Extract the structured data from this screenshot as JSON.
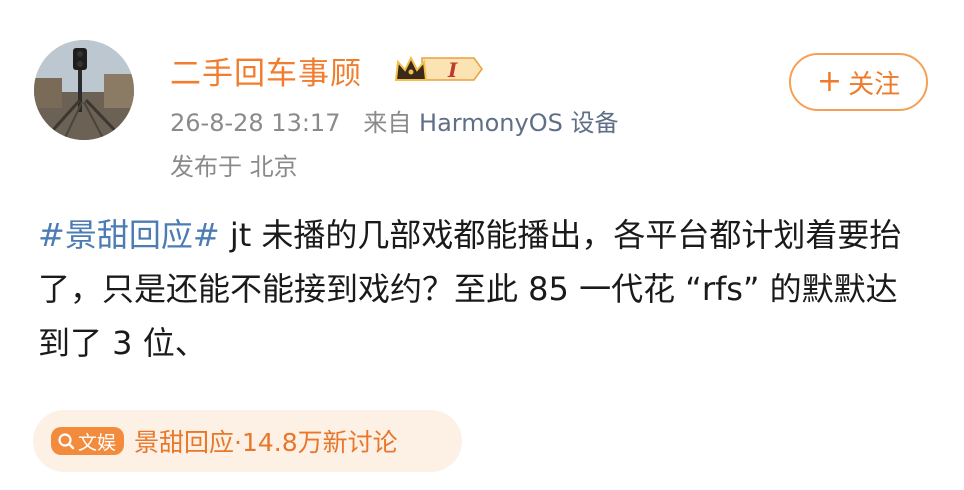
{
  "post": {
    "author": {
      "name": "二手回车事顾",
      "avatar_icon": "railway-signal-photo",
      "level_badge": {
        "icon": "crown-level-icon",
        "text": "I"
      }
    },
    "meta": {
      "time": "26-8-28 13:17",
      "source_prefix": "来自",
      "device": "HarmonyOS 设备"
    },
    "location": "发布于 北京",
    "follow_button": {
      "plus": "+",
      "label": "关注"
    },
    "content": {
      "topic": "#景甜回应#",
      "text": " jt 未播的几部戏都能播出，各平台都计划着要抬了，只是还能不能接到戏约？至此 85 一代花 “rfs” 的默默达到了 3 位、"
    },
    "topic_chip": {
      "tag_icon": "search-icon",
      "tag_label": "文娱",
      "text": "景甜回应·14.8万新讨论"
    }
  },
  "colors": {
    "accent_orange": "#f27d2f",
    "topic_blue": "#4c7cb4",
    "meta_gray": "#8a8a8a",
    "chip_bg": "#fdf1e6"
  }
}
